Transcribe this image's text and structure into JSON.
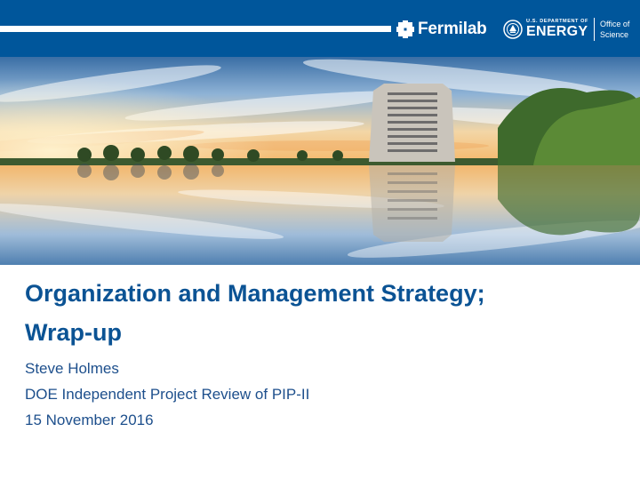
{
  "header": {
    "brand": "Fermilab",
    "doe_department": "U.S. DEPARTMENT OF",
    "doe_name": "ENERGY",
    "office_line1": "Office of",
    "office_line2": "Science",
    "colors": {
      "header_bg": "#00569b",
      "title": "#0b5394",
      "subtitle": "#1d4f8c"
    },
    "icons": {
      "brand": "fermilab-logo-icon",
      "seal": "doe-seal-icon"
    }
  },
  "slide": {
    "title_line1": "Organization and Management Strategy;",
    "title_line2": "Wrap-up",
    "author": "Steve Holmes",
    "event": "DOE Independent Project Review of PIP-II",
    "date": "15 November 2016"
  }
}
